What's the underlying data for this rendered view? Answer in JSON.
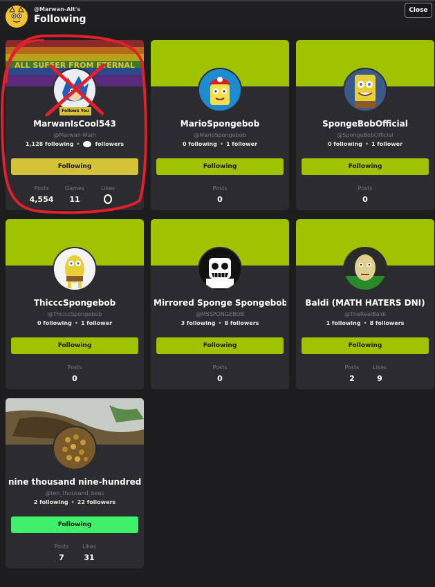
{
  "header": {
    "owner": "@Marwan-Alt's",
    "title": "Following",
    "close_label": "Close"
  },
  "ui": {
    "follows_you_badge": "Follows You",
    "posts_label": "Posts",
    "games_label": "Games",
    "likes_label": "Likes",
    "following_button": "Following"
  },
  "cards": [
    {
      "name": "MarwanIsCool543",
      "handle": "@Marwan-Main",
      "following": "1,128 following",
      "followers": "followers",
      "posts": "4,554",
      "games": "11",
      "banner_text": "ALL SUFFER FROM ETERNAL"
    },
    {
      "name": "MarioSpongebob",
      "handle": "@MarioSpongebob",
      "following": "0 following",
      "followers": "1 follower",
      "posts": "0"
    },
    {
      "name": "SpongeBobOfficial",
      "handle": "@SpongeBobOfficial",
      "following": "0 following",
      "followers": "1 follower",
      "posts": "0"
    },
    {
      "name": "ThicccSpongebob",
      "handle": "@ThicccSpongebob",
      "following": "0 following",
      "followers": "1 follower",
      "posts": "0"
    },
    {
      "name": "Mirrored Sponge Spongebob",
      "handle": "@MSSPONGEBOB",
      "following": "3 following",
      "followers": "8 followers",
      "posts": "0"
    },
    {
      "name": "Baldi (MATH HATERS DNI)",
      "handle": "@TheRealBaldi",
      "following": "1 following",
      "followers": "8 followers",
      "posts": "2",
      "likes": "9"
    },
    {
      "name": "nine thousand nine-hundred ...",
      "handle": "@ten_thousand_bees",
      "following": "2 following",
      "followers": "22 followers",
      "posts": "7",
      "likes": "31"
    }
  ],
  "colors": {
    "banner": "#9fc300",
    "button": "#9fc300",
    "button_first": "#d4c338",
    "button_last": "#3ef06a",
    "annotation": "#e0202a"
  }
}
